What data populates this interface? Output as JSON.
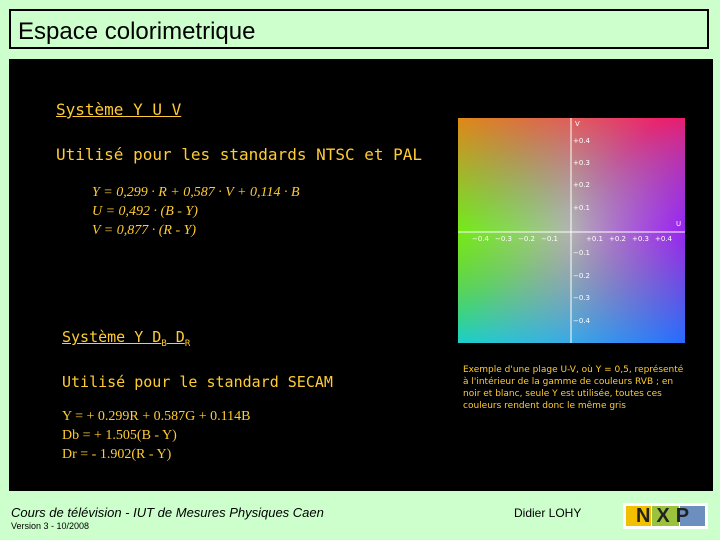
{
  "slide": {
    "title": "Espace colorimetrique",
    "yuv_title": "Système Y U V",
    "yuv_usage": "Utilisé pour les standards NTSC et PAL",
    "yuv_formulas": [
      "Y = 0,299 · R + 0,587 · V + 0,114 · B",
      "U = 0,492 · (B - Y)",
      "V = 0,877 · (R - Y)"
    ],
    "ydd_title_prefix": "Système Y D",
    "ydd_title_sub1": "B",
    "ydd_title_mid": " D",
    "ydd_title_sub2": "R",
    "ydd_usage": "Utilisé pour le standard SECAM",
    "ydd_formulas": [
      "Y = + 0.299R + 0.587G + 0.114B",
      "Db = + 1.505(B - Y)",
      "Dr = - 1.902(R - Y)"
    ],
    "caption": "Exemple d'une plage U-V, où Y = 0,5, représenté à l'intérieur de la gamme de couleurs RVB ; en noir et blanc, seule Y est utilisée, toutes ces couleurs rendent donc le même gris"
  },
  "uv_plot": {
    "axis_v_label": "V",
    "axis_u_label": "U",
    "v_ticks_pos": [
      "+0.4",
      "+0.3",
      "+0.2",
      "+0.1"
    ],
    "v_ticks_neg": [
      "−0.1",
      "−0.2",
      "−0.3",
      "−0.4"
    ],
    "u_ticks_neg": [
      "−0.4",
      "−0.3",
      "−0.2",
      "−0.1"
    ],
    "u_ticks_pos": [
      "+0.1",
      "+0.2",
      "+0.3",
      "+0.4"
    ]
  },
  "footer": {
    "course": "Cours de télévision - IUT de Mesures Physiques Caen",
    "version": "Version 3 - 10/2008",
    "author": "Didier LOHY",
    "logo": "NXP"
  }
}
